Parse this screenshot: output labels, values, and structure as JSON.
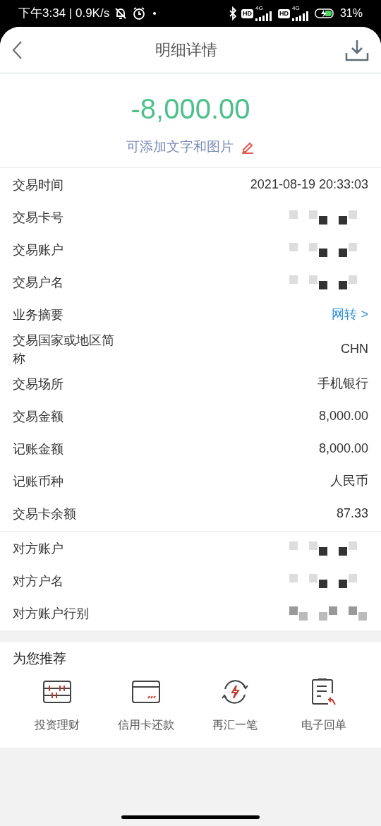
{
  "status_bar": {
    "time": "下午3:34 | 0.9K/s",
    "signals": [
      {
        "badge": "HD",
        "network": "4G"
      },
      {
        "badge": "HD",
        "network": "4G"
      }
    ],
    "battery": "31%"
  },
  "header": {
    "title": "明细详情"
  },
  "amount": "-8,000.00",
  "note_link": "可添加文字和图片",
  "sections": [
    {
      "rows": [
        {
          "label": "交易时间",
          "kind": "text",
          "value": "2021-08-19 20:33:03"
        },
        {
          "label": "交易卡号",
          "kind": "redacted"
        },
        {
          "label": "交易账户",
          "kind": "redacted"
        },
        {
          "label": "交易户名",
          "kind": "redacted"
        },
        {
          "label": "业务摘要",
          "kind": "link",
          "value": "网转 >"
        },
        {
          "label": "交易国家或地区简称",
          "kind": "text",
          "value": "CHN"
        },
        {
          "label": "交易场所",
          "kind": "text",
          "value": "手机银行"
        },
        {
          "label": "交易金额",
          "kind": "text",
          "value": "8,000.00"
        },
        {
          "label": "记账金额",
          "kind": "text",
          "value": "8,000.00"
        },
        {
          "label": "记账币种",
          "kind": "text",
          "value": "人民币"
        },
        {
          "label": "交易卡余额",
          "kind": "text",
          "value": "87.33"
        }
      ]
    },
    {
      "rows": [
        {
          "label": "对方账户",
          "kind": "redacted"
        },
        {
          "label": "对方户名",
          "kind": "redacted"
        },
        {
          "label": "对方账户行别",
          "kind": "redacted"
        }
      ]
    }
  ],
  "recommend": {
    "title": "为您推荐",
    "items": [
      {
        "label": "投资理财",
        "kind": "abacus"
      },
      {
        "label": "信用卡还款",
        "kind": "card"
      },
      {
        "label": "再汇一笔",
        "kind": "repeat"
      },
      {
        "label": "电子回单",
        "kind": "receipt"
      }
    ]
  }
}
